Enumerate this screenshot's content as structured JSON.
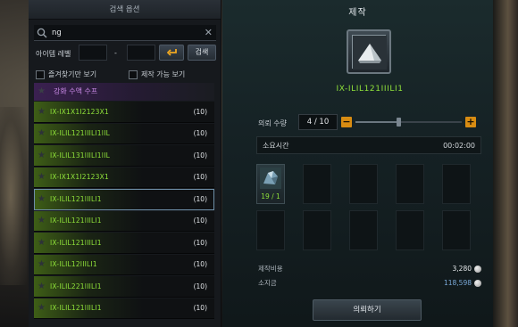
{
  "left": {
    "header_title": "검색 옵션",
    "search": {
      "value": "ng",
      "placeholder": ""
    },
    "level_label": "아이템 레벨",
    "level_min": "",
    "level_max": "",
    "level_separator": "-",
    "search_button": "검색",
    "filter_favorites": "즐겨찾기만 보기",
    "filter_craftable": "제작 가능 보기",
    "category": "강화 수액 수프",
    "items": [
      {
        "name": "IX-IX1X1I2123X1",
        "count": "(10)"
      },
      {
        "name": "IX-ILIL121IIILI1IIL",
        "count": "(10)"
      },
      {
        "name": "IX-ILIL131IIILI1IIL",
        "count": "(10)"
      },
      {
        "name": "IX-IX1X1I2123X1",
        "count": "(10)"
      },
      {
        "name": "IX-ILIL121IIILI1",
        "count": "(10)"
      },
      {
        "name": "IX-ILIL121IIILI1",
        "count": "(10)"
      },
      {
        "name": "IX-ILIL121IIILI1",
        "count": "(10)"
      },
      {
        "name": "IX-ILIL12IIILI1",
        "count": "(10)"
      },
      {
        "name": "IX-ILIL221IIILI1",
        "count": "(10)"
      },
      {
        "name": "IX-ILIL121IIILI1",
        "count": "(10)"
      }
    ],
    "selected_index": 4
  },
  "right": {
    "title": "제작",
    "item_name": "IX-ILIL121IIILI1",
    "quantity_label": "의뢰 수량",
    "quantity_value": "4 / 10",
    "quantity_fraction": 0.4,
    "time_label": "소요시간",
    "time_value": "00:02:00",
    "materials": [
      {
        "count": "19 / 1",
        "icon": "crystal-ore-icon"
      }
    ],
    "cost_label": "제작비용",
    "cost_value": "3,280",
    "money_label": "소지금",
    "money_value": "118,598",
    "request_button": "의뢰하기"
  },
  "colors": {
    "item_green": "#8fe13a",
    "category_purple": "#c98ae6",
    "accent_orange": "#d88c12"
  }
}
